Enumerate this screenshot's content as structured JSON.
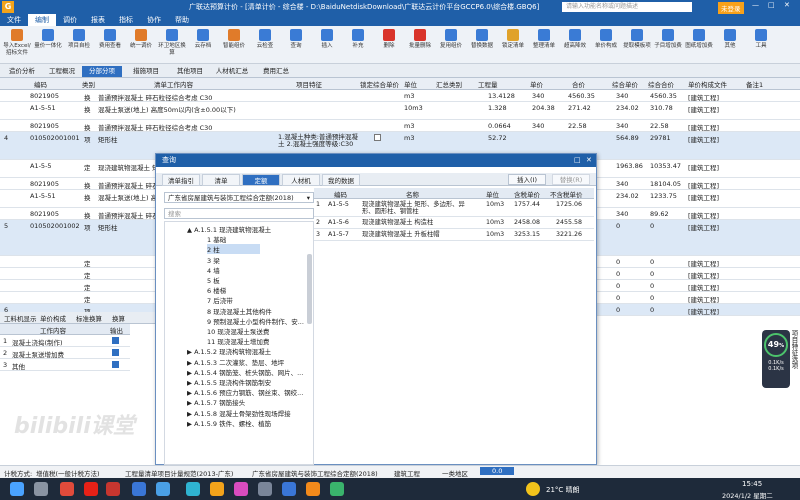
{
  "title_bar": {
    "logo": "G",
    "text": "广联达预算计价 - [清单计价 - 综合楼 - D:\\BaiduNetdiskDownload\\广联达云计价平台GCCP6.0\\综合楼.GBQ6]",
    "search_placeholder": "请输入功能名称或问题描述",
    "user": "未登录"
  },
  "menu": [
    "文件",
    "编制",
    "调价",
    "报表",
    "指标",
    "协作",
    "帮助"
  ],
  "menu_active": "编制",
  "ribbon": [
    {
      "label": "导入Excel/招标文件",
      "color": "#e07b2a"
    },
    {
      "label": "量价一体化",
      "color": "#3a7bd5"
    },
    {
      "label": "项目自检",
      "color": "#3a7bd5"
    },
    {
      "label": "费用查看",
      "color": "#3a7bd5"
    },
    {
      "label": "统一调价",
      "color": "#e07b2a"
    },
    {
      "label": "环卫地区换算",
      "color": "#3a7bd5"
    },
    {
      "label": "云存档",
      "color": "#3a7bd5"
    },
    {
      "label": "智能组价",
      "color": "#e07b2a"
    },
    {
      "label": "云检查",
      "color": "#3a7bd5"
    },
    {
      "label": "查询",
      "color": "#3a7bd5"
    },
    {
      "label": "插入",
      "color": "#3a7bd5"
    },
    {
      "label": "补充",
      "color": "#3a7bd5"
    },
    {
      "label": "删除",
      "color": "#d9342b"
    },
    {
      "label": "批量删除",
      "color": "#d9342b"
    },
    {
      "label": "复用组价",
      "color": "#3a7bd5"
    },
    {
      "label": "替换数据",
      "color": "#3a7bd5"
    },
    {
      "label": "锁定清单",
      "color": "#e0a22a"
    },
    {
      "label": "整理清单",
      "color": "#3a7bd5"
    },
    {
      "label": "超高降效",
      "color": "#3a7bd5"
    },
    {
      "label": "单价构成",
      "color": "#3a7bd5"
    },
    {
      "label": "提取模板项",
      "color": "#3a7bd5"
    },
    {
      "label": "子目增加费",
      "color": "#3a7bd5"
    },
    {
      "label": "图纸增加费",
      "color": "#3a7bd5"
    },
    {
      "label": "其他",
      "color": "#3a7bd5"
    },
    {
      "label": "工具",
      "color": "#3a7bd5"
    }
  ],
  "view_tabs": [
    "造价分析",
    "工程概况",
    "分部分项",
    "措施项目",
    "其他项目",
    "人材机汇总",
    "费用汇总"
  ],
  "view_tab_active": "分部分项",
  "grid_headers": [
    "编码",
    "类别",
    "清单工作内容",
    "项目特征",
    "锁定综合单价",
    "单位",
    "汇总类别",
    "工程量",
    "单价",
    "合价",
    "综合单价",
    "综合合价",
    "单价构成文件",
    "备注1"
  ],
  "grid_rows": [
    {
      "no": "",
      "code": "8021905",
      "type": "换",
      "name": "普通预拌混凝土 碎石粒径综合考虑 C30",
      "unit": "m3",
      "qty": "13.4128",
      "price": "340",
      "total": "4560.35",
      "unit_total": "340",
      "sum": "4560.35",
      "file": "[建筑工程]",
      "blue": false
    },
    {
      "no": "",
      "code": "A1-5-51",
      "type": "换",
      "name": "混凝土泵送(地上) 高度50m以内(含±0.00以下)",
      "unit": "10m3",
      "qty": "1.328",
      "price": "204.38",
      "total": "271.42",
      "unit_total": "234.02",
      "sum": "310.78",
      "file": "[建筑工程]",
      "blue": false
    },
    {
      "no": "",
      "code": "8021905",
      "type": "换",
      "name": "普通预拌混凝土 碎石粒径综合考虑 C30",
      "unit": "m3",
      "qty": "0.0664",
      "price": "340",
      "total": "22.58",
      "unit_total": "340",
      "sum": "22.58",
      "file": "[建筑工程]",
      "blue": false
    },
    {
      "no": "4",
      "code": "010502001001",
      "type": "项",
      "name": "矩形柱",
      "feature": "1.混凝土种类:普通预拌混凝土 2.混凝土强度等级:C30",
      "unit": "m3",
      "qty": "52.72",
      "price": "",
      "total": "",
      "unit_total": "564.89",
      "sum": "29781",
      "file": "[建筑工程]",
      "blue": true
    },
    {
      "no": "",
      "code": "A1-5-5",
      "type": "定",
      "name": "现浇建筑物混凝土 矩形、多边形、异形、圆形柱、钢管柱",
      "unit": "",
      "qty": "",
      "price": "",
      "total": "",
      "unit_total": "1963.86",
      "sum": "10353.47",
      "file": "[建筑工程]",
      "blue": false
    },
    {
      "no": "",
      "code": "8021905",
      "type": "换",
      "name": "普通预拌混凝土 碎石粒径综合考虑 C30",
      "unit": "",
      "qty": "",
      "price": "",
      "total": "",
      "unit_total": "340",
      "sum": "18104.05",
      "file": "[建筑工程]",
      "blue": false
    },
    {
      "no": "",
      "code": "A1-5-51",
      "type": "换",
      "name": "混凝土泵送(地上) 高度50m以内(含±0.00以下)",
      "unit": "",
      "qty": "",
      "price": "",
      "total": "",
      "unit_total": "234.02",
      "sum": "1233.75",
      "file": "[建筑工程]",
      "blue": false
    },
    {
      "no": "",
      "code": "8021905",
      "type": "换",
      "name": "普通预拌混凝土 碎石粒径综合考虑 C30",
      "unit": "",
      "qty": "",
      "price": "",
      "total": "",
      "unit_total": "340",
      "sum": "89.62",
      "file": "[建筑工程]",
      "blue": false
    },
    {
      "no": "5",
      "code": "010502001002",
      "type": "项",
      "name": "矩形柱",
      "unit": "",
      "qty": "",
      "price": "",
      "total": "",
      "unit_total": "0",
      "sum": "0",
      "file": "[建筑工程]",
      "blue": true
    },
    {
      "no": "",
      "code": "",
      "type": "定",
      "name": "",
      "unit": "",
      "qty": "",
      "price": "",
      "total": "",
      "unit_total": "0",
      "sum": "0",
      "file": "[建筑工程]",
      "blue": false
    },
    {
      "no": "",
      "code": "",
      "type": "定",
      "name": "",
      "unit": "",
      "qty": "",
      "price": "",
      "total": "",
      "unit_total": "0",
      "sum": "0",
      "file": "[建筑工程]",
      "blue": false
    },
    {
      "no": "",
      "code": "",
      "type": "定",
      "name": "",
      "unit": "",
      "qty": "",
      "price": "",
      "total": "",
      "unit_total": "0",
      "sum": "0",
      "file": "[建筑工程]",
      "blue": false
    },
    {
      "no": "",
      "code": "",
      "type": "定",
      "name": "",
      "unit": "",
      "qty": "",
      "price": "",
      "total": "",
      "unit_total": "0",
      "sum": "0",
      "file": "[建筑工程]",
      "blue": false
    },
    {
      "no": "6",
      "code": "",
      "type": "项",
      "name": "",
      "unit": "",
      "qty": "",
      "price": "",
      "total": "",
      "unit_total": "0",
      "sum": "0",
      "file": "[建筑工程]",
      "blue": true
    }
  ],
  "dialog": {
    "title": "查询",
    "tabs": [
      "清单指引",
      "清单",
      "定额",
      "人材机",
      "我的数据"
    ],
    "tab_active": "定额",
    "insert_label": "插入(I)",
    "replace_label": "替换(R)",
    "library": "广东省房屋建筑与装饰工程综合定额(2018)",
    "search_placeholder": "搜索",
    "tree": [
      {
        "text": "A.1.5.1 现浇建筑物混凝土",
        "indent": 0,
        "arrow": "▲"
      },
      {
        "text": "1 基础",
        "indent": 2,
        "arrow": ""
      },
      {
        "text": "2 柱",
        "indent": 2,
        "arrow": "",
        "selected": true
      },
      {
        "text": "3 梁",
        "indent": 2,
        "arrow": ""
      },
      {
        "text": "4 墙",
        "indent": 2,
        "arrow": ""
      },
      {
        "text": "5 板",
        "indent": 2,
        "arrow": ""
      },
      {
        "text": "6 楼梯",
        "indent": 2,
        "arrow": ""
      },
      {
        "text": "7 后浇带",
        "indent": 2,
        "arrow": ""
      },
      {
        "text": "8 现浇混凝土其他构件",
        "indent": 2,
        "arrow": ""
      },
      {
        "text": "9 预制混凝土小型构件制作、安...",
        "indent": 2,
        "arrow": ""
      },
      {
        "text": "10 现浇混凝土泵送费",
        "indent": 2,
        "arrow": ""
      },
      {
        "text": "11 现浇混凝土增加费",
        "indent": 2,
        "arrow": ""
      },
      {
        "text": "A.1.5.2 现浇构筑物混凝土",
        "indent": 0,
        "arrow": "▶"
      },
      {
        "text": "A.1.5.3 二次灌浆、垫层、地坪",
        "indent": 0,
        "arrow": "▶"
      },
      {
        "text": "A.1.5.4 钢筋笼、桩头钢筋、网片、...",
        "indent": 0,
        "arrow": "▶"
      },
      {
        "text": "A.1.5.5 现浇构件钢筋制安",
        "indent": 0,
        "arrow": "▶"
      },
      {
        "text": "A.1.5.6 预应力钢筋、钢丝束、钢绞...",
        "indent": 0,
        "arrow": "▶"
      },
      {
        "text": "A.1.5.7 钢筋接头",
        "indent": 0,
        "arrow": "▶"
      },
      {
        "text": "A.1.5.8 混凝土骨架劲性现场焊接",
        "indent": 0,
        "arrow": "▶"
      },
      {
        "text": "A.1.5.9 铁件、螺栓、植筋",
        "indent": 0,
        "arrow": "▶"
      }
    ],
    "headers": [
      "编码",
      "名称",
      "单位",
      "含税单价",
      "不含税单价"
    ],
    "rows": [
      {
        "no": "1",
        "code": "A1-5-5",
        "name": "现浇建筑物混凝土 矩形、多边形、异形、圆形柱、钢管柱",
        "unit": "10m3",
        "tax": "1757.44",
        "notax": "1725.06"
      },
      {
        "no": "2",
        "code": "A1-5-6",
        "name": "现浇建筑物混凝土 构造柱",
        "unit": "10m3",
        "tax": "2458.08",
        "notax": "2455.58"
      },
      {
        "no": "3",
        "code": "A1-5-7",
        "name": "现浇建筑物混凝土 升板柱帽",
        "unit": "10m3",
        "tax": "3253.15",
        "notax": "3221.26"
      }
    ]
  },
  "bottom_tabs": [
    "工料机显示",
    "单价构成",
    "标准换算",
    "换算"
  ],
  "work_header": [
    "工作内容",
    "输出"
  ],
  "work_rows": [
    {
      "no": "1",
      "text": "混凝土浇捣(制作)"
    },
    {
      "no": "2",
      "text": "混凝土泵送增加费"
    },
    {
      "no": "3",
      "text": "其他"
    }
  ],
  "status": {
    "tax_label": "计税方式:",
    "tax_value": "增值税(一般计税方法)",
    "rule": "工程量清单项目计量规范(2013-广东)",
    "quota": "广东省房屋建筑与装饰工程综合定额(2018)",
    "building": "建筑工程",
    "region": "一类地区",
    "badge": "0.0"
  },
  "side_widget": {
    "percent": "49",
    "unit": "%",
    "up": "0.1K/s",
    "down": "0.1K/s",
    "vertical": "项目特征选项"
  },
  "taskbar": {
    "weather": "21°C 晴朗",
    "time": "15:45",
    "date": "2024/1/2 星期二"
  },
  "watermark": "bilibili课堂"
}
